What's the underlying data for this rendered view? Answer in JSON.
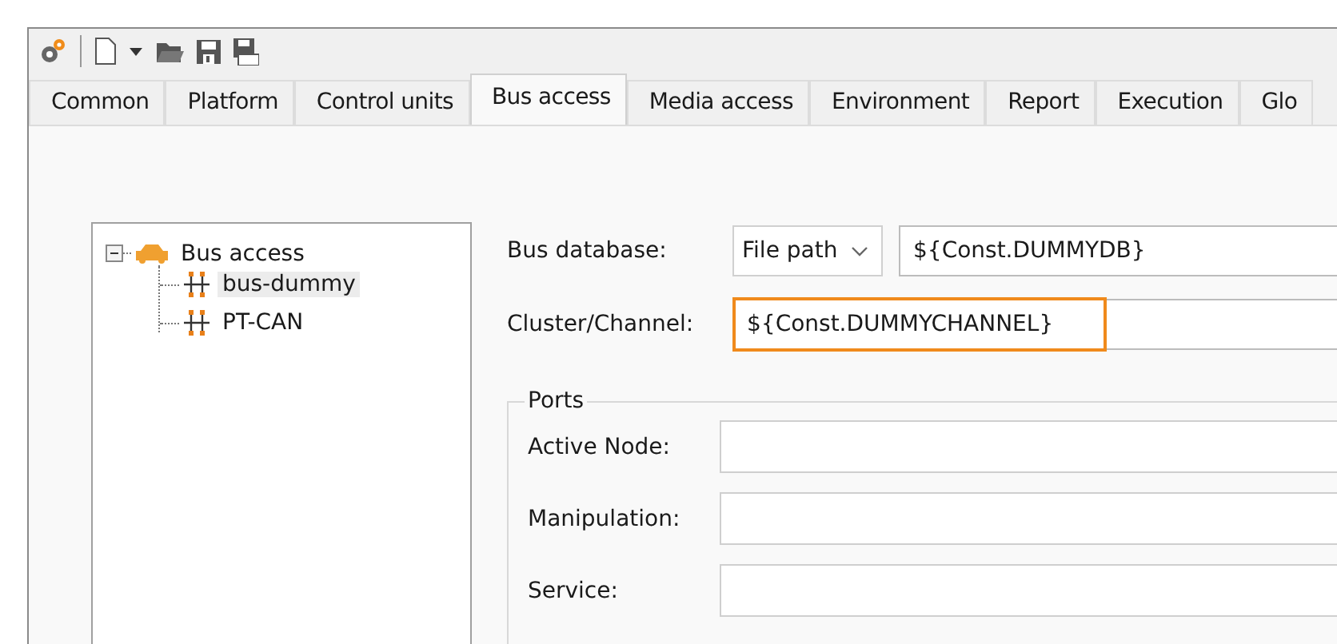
{
  "tabs": [
    {
      "label": "Common",
      "selected": false
    },
    {
      "label": "Platform",
      "selected": false
    },
    {
      "label": "Control units",
      "selected": false
    },
    {
      "label": "Bus access",
      "selected": true
    },
    {
      "label": "Media access",
      "selected": false
    },
    {
      "label": "Environment",
      "selected": false
    },
    {
      "label": "Report",
      "selected": false
    },
    {
      "label": "Execution",
      "selected": false
    },
    {
      "label": "Glo",
      "selected": false
    }
  ],
  "tree": [
    {
      "label": "Bus access",
      "kind": "bus",
      "expanded": true,
      "selected": false,
      "children": [
        {
          "label": "bus-dummy",
          "kind": "channel",
          "selected": true
        },
        {
          "label": "PT-CAN",
          "kind": "channel",
          "selected": false
        }
      ]
    }
  ],
  "bus_database": {
    "label": "Bus database:",
    "type": "File path",
    "value": "${Const.DUMMYDB}"
  },
  "cluster_channel": {
    "label": "Cluster/Channel:",
    "value": "${Const.DUMMYCHANNEL}",
    "highlighted": true
  },
  "ports": {
    "title": "Ports",
    "fields": [
      {
        "label": "Active Node:"
      },
      {
        "label": "Manipulation:"
      },
      {
        "label": "Service:"
      }
    ]
  }
}
